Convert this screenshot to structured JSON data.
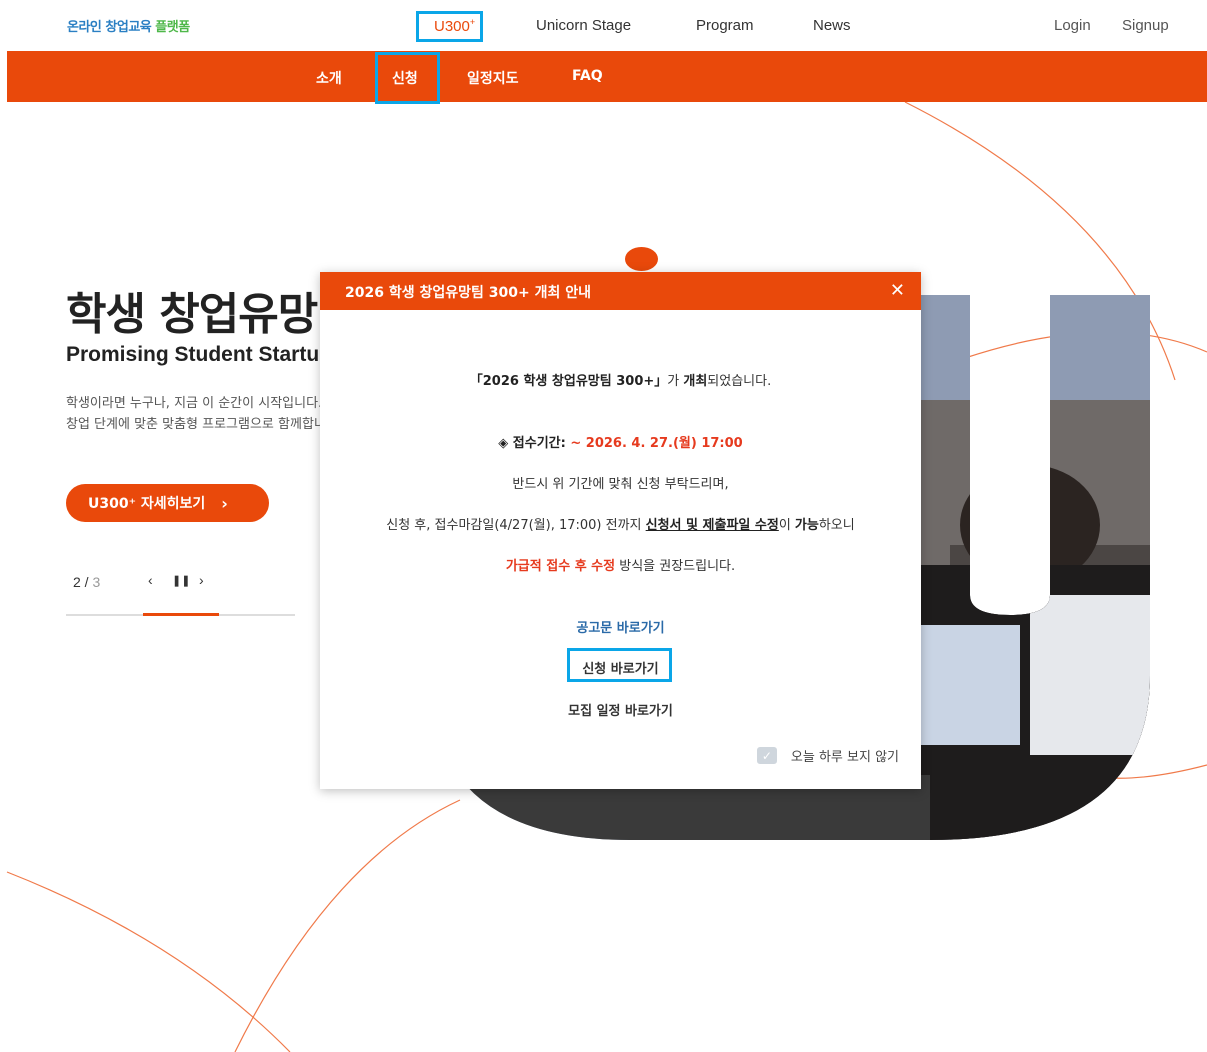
{
  "header": {
    "logo_part1": "온라인 창업교육",
    "logo_part2": "플랫폼",
    "nav": [
      "U300",
      "Unicorn Stage",
      "Program",
      "News"
    ],
    "u300_sup": "+",
    "login": "Login",
    "signup": "Signup"
  },
  "subnav": {
    "items": [
      "소개",
      "신청",
      "일정지도",
      "FAQ"
    ]
  },
  "hero": {
    "title": "학생 창업유망팀 300+",
    "subtitle": "Promising Student Startup Team 300+",
    "desc_line1": "학생이라면 누구나, 지금 이 순간이 시작입니다.",
    "desc_line2": "창업 단계에 맞춘 맞춤형 프로그램으로 함께합니다.",
    "cta": "U300⁺ 자세히보기",
    "cta_chevron": "›",
    "pager_current": "2",
    "pager_sep": " / ",
    "pager_total": "3",
    "progress_fraction": 0.33
  },
  "modal": {
    "title": "2026 학생 창업유망팀 300+ 개최 안내",
    "close_symbol": "✕",
    "line1_a": "「2026 학생 창업유망팀 300+」",
    "line1_b": "가 ",
    "line1_c": "개최",
    "line1_d": "되었습니다.",
    "period_label": "◈ 접수기간:",
    "period_value": " ~ 2026. 4. 27.(월) 17:00",
    "line3": "반드시 위 기간에 맞춰 신청 부탁드리며,",
    "line4_a": "신청 후, 접수마감일(4/27(월), 17:00) 전까지 ",
    "line4_b": "신청서 및 제출파일 수정",
    "line4_c": "이 ",
    "line4_d": "가능",
    "line4_e": "하오니",
    "line5_a": "가급적 접수 후 수정",
    "line5_b": " 방식을 권장드립니다.",
    "link_notice": "공고문 바로가기",
    "link_apply": "신청 바로가기",
    "link_schedule": "모집 일정 바로가기",
    "dismiss": "오늘 하루 보지 않기",
    "dismiss_check": "✓"
  },
  "colors": {
    "accent": "#e9490b",
    "highlight": "#0aa6e8",
    "link_blue": "#2a6aa8"
  }
}
